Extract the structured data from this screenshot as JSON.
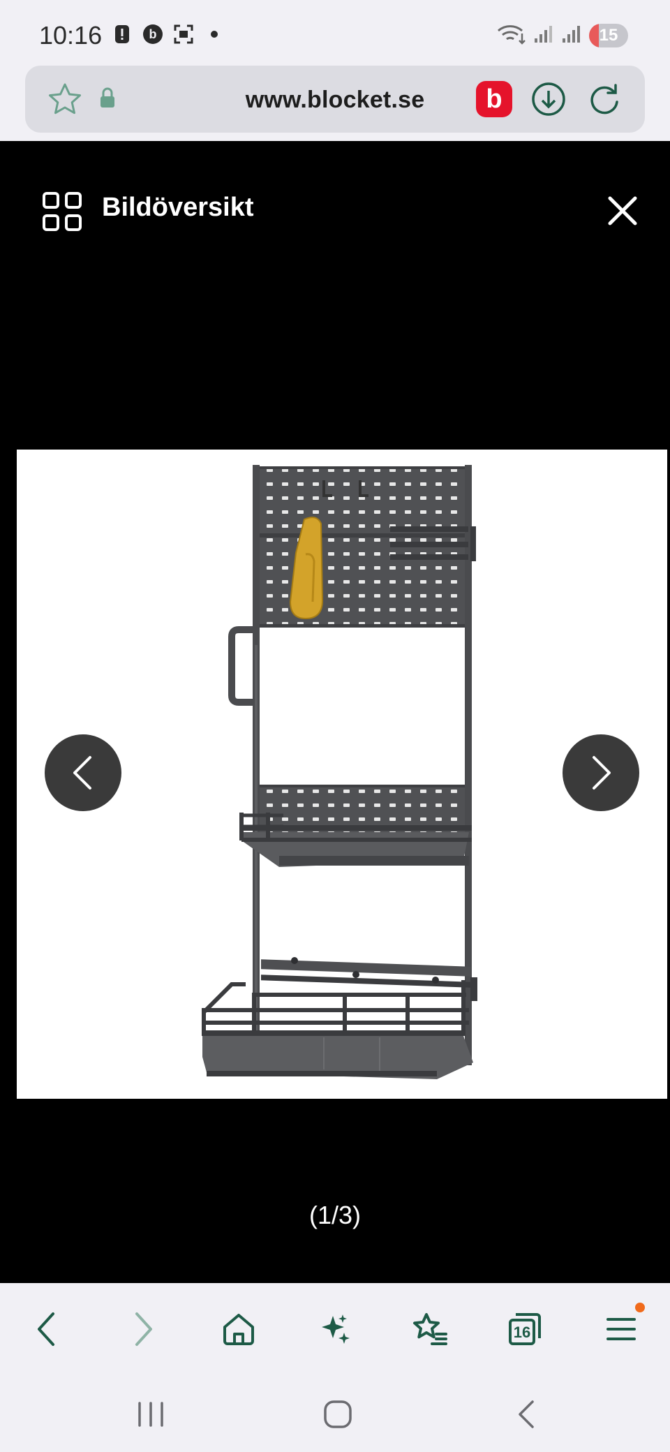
{
  "status_bar": {
    "time": "10:16",
    "battery": "15",
    "icons": [
      "alert-icon",
      "blocket-notification-icon",
      "screenshot-icon",
      "dot-icon",
      "wifi-icon",
      "signal-icon",
      "signal-icon-2"
    ]
  },
  "url_bar": {
    "url": "www.blocket.se",
    "brand_letter": "b",
    "brand_color": "#e5132b"
  },
  "viewer": {
    "title": "Bildöversikt",
    "counter": "(1/3)",
    "accent": "#1d5a46"
  },
  "toolbar": {
    "buttons": [
      "back",
      "forward",
      "home",
      "ai-assist",
      "bookmarks",
      "tabs",
      "menu"
    ],
    "tabs_count": "16"
  }
}
